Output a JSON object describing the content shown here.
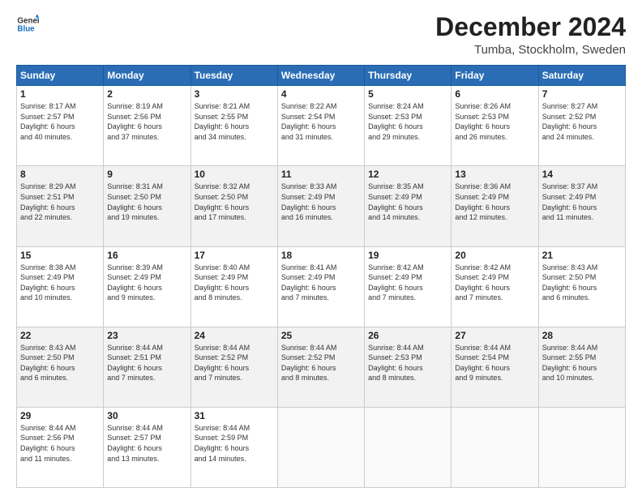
{
  "logo": {
    "line1": "General",
    "line2": "Blue"
  },
  "title": "December 2024",
  "subtitle": "Tumba, Stockholm, Sweden",
  "weekdays": [
    "Sunday",
    "Monday",
    "Tuesday",
    "Wednesday",
    "Thursday",
    "Friday",
    "Saturday"
  ],
  "weeks": [
    [
      {
        "day": "1",
        "sunrise": "8:17 AM",
        "sunset": "2:57 PM",
        "daylight": "6 hours and 40 minutes."
      },
      {
        "day": "2",
        "sunrise": "8:19 AM",
        "sunset": "2:56 PM",
        "daylight": "6 hours and 37 minutes."
      },
      {
        "day": "3",
        "sunrise": "8:21 AM",
        "sunset": "2:55 PM",
        "daylight": "6 hours and 34 minutes."
      },
      {
        "day": "4",
        "sunrise": "8:22 AM",
        "sunset": "2:54 PM",
        "daylight": "6 hours and 31 minutes."
      },
      {
        "day": "5",
        "sunrise": "8:24 AM",
        "sunset": "2:53 PM",
        "daylight": "6 hours and 29 minutes."
      },
      {
        "day": "6",
        "sunrise": "8:26 AM",
        "sunset": "2:53 PM",
        "daylight": "6 hours and 26 minutes."
      },
      {
        "day": "7",
        "sunrise": "8:27 AM",
        "sunset": "2:52 PM",
        "daylight": "6 hours and 24 minutes."
      }
    ],
    [
      {
        "day": "8",
        "sunrise": "8:29 AM",
        "sunset": "2:51 PM",
        "daylight": "6 hours and 22 minutes."
      },
      {
        "day": "9",
        "sunrise": "8:31 AM",
        "sunset": "2:50 PM",
        "daylight": "6 hours and 19 minutes."
      },
      {
        "day": "10",
        "sunrise": "8:32 AM",
        "sunset": "2:50 PM",
        "daylight": "6 hours and 17 minutes."
      },
      {
        "day": "11",
        "sunrise": "8:33 AM",
        "sunset": "2:49 PM",
        "daylight": "6 hours and 16 minutes."
      },
      {
        "day": "12",
        "sunrise": "8:35 AM",
        "sunset": "2:49 PM",
        "daylight": "6 hours and 14 minutes."
      },
      {
        "day": "13",
        "sunrise": "8:36 AM",
        "sunset": "2:49 PM",
        "daylight": "6 hours and 12 minutes."
      },
      {
        "day": "14",
        "sunrise": "8:37 AM",
        "sunset": "2:49 PM",
        "daylight": "6 hours and 11 minutes."
      }
    ],
    [
      {
        "day": "15",
        "sunrise": "8:38 AM",
        "sunset": "2:49 PM",
        "daylight": "6 hours and 10 minutes."
      },
      {
        "day": "16",
        "sunrise": "8:39 AM",
        "sunset": "2:49 PM",
        "daylight": "6 hours and 9 minutes."
      },
      {
        "day": "17",
        "sunrise": "8:40 AM",
        "sunset": "2:49 PM",
        "daylight": "6 hours and 8 minutes."
      },
      {
        "day": "18",
        "sunrise": "8:41 AM",
        "sunset": "2:49 PM",
        "daylight": "6 hours and 7 minutes."
      },
      {
        "day": "19",
        "sunrise": "8:42 AM",
        "sunset": "2:49 PM",
        "daylight": "6 hours and 7 minutes."
      },
      {
        "day": "20",
        "sunrise": "8:42 AM",
        "sunset": "2:49 PM",
        "daylight": "6 hours and 7 minutes."
      },
      {
        "day": "21",
        "sunrise": "8:43 AM",
        "sunset": "2:50 PM",
        "daylight": "6 hours and 6 minutes."
      }
    ],
    [
      {
        "day": "22",
        "sunrise": "8:43 AM",
        "sunset": "2:50 PM",
        "daylight": "6 hours and 6 minutes."
      },
      {
        "day": "23",
        "sunrise": "8:44 AM",
        "sunset": "2:51 PM",
        "daylight": "6 hours and 7 minutes."
      },
      {
        "day": "24",
        "sunrise": "8:44 AM",
        "sunset": "2:52 PM",
        "daylight": "6 hours and 7 minutes."
      },
      {
        "day": "25",
        "sunrise": "8:44 AM",
        "sunset": "2:52 PM",
        "daylight": "6 hours and 8 minutes."
      },
      {
        "day": "26",
        "sunrise": "8:44 AM",
        "sunset": "2:53 PM",
        "daylight": "6 hours and 8 minutes."
      },
      {
        "day": "27",
        "sunrise": "8:44 AM",
        "sunset": "2:54 PM",
        "daylight": "6 hours and 9 minutes."
      },
      {
        "day": "28",
        "sunrise": "8:44 AM",
        "sunset": "2:55 PM",
        "daylight": "6 hours and 10 minutes."
      }
    ],
    [
      {
        "day": "29",
        "sunrise": "8:44 AM",
        "sunset": "2:56 PM",
        "daylight": "6 hours and 11 minutes."
      },
      {
        "day": "30",
        "sunrise": "8:44 AM",
        "sunset": "2:57 PM",
        "daylight": "6 hours and 13 minutes."
      },
      {
        "day": "31",
        "sunrise": "8:44 AM",
        "sunset": "2:59 PM",
        "daylight": "6 hours and 14 minutes."
      },
      null,
      null,
      null,
      null
    ]
  ]
}
